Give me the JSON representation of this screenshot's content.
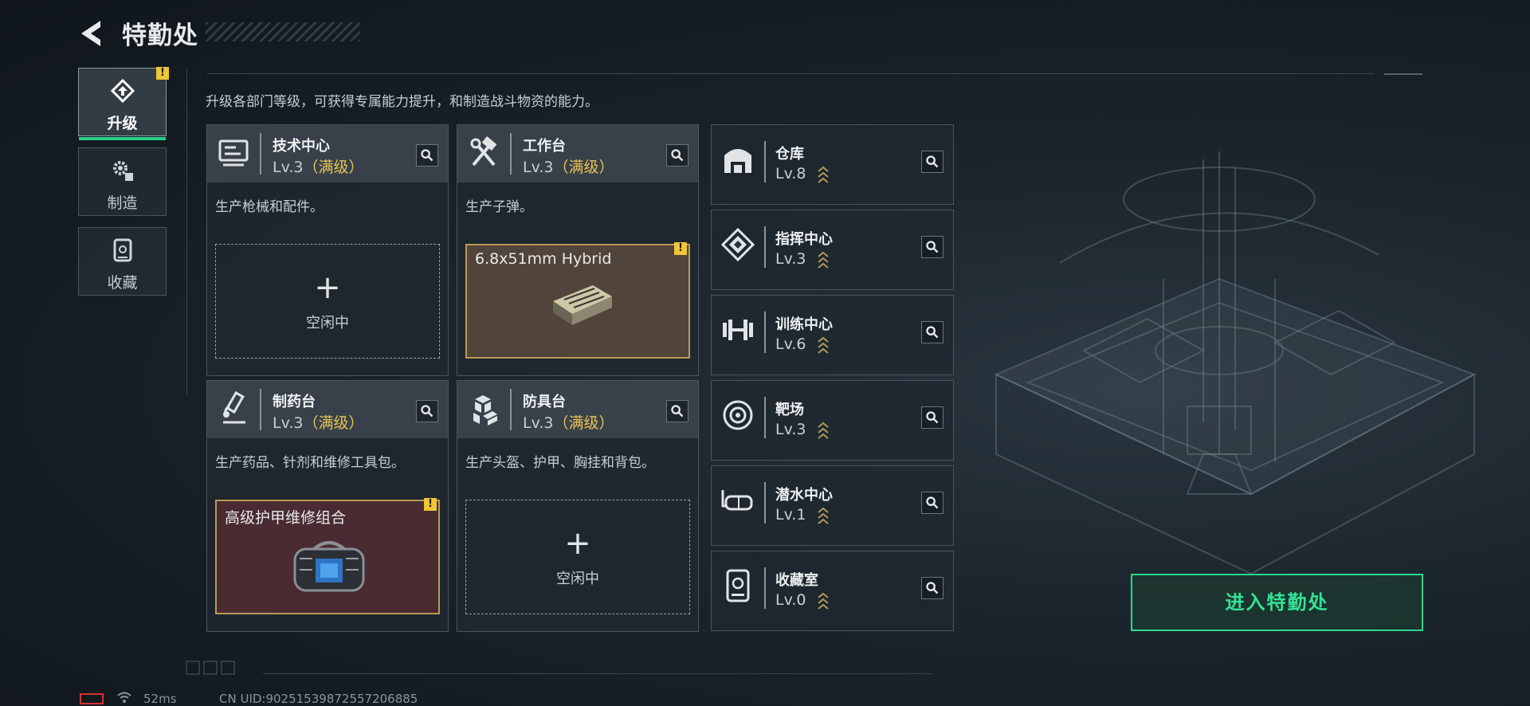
{
  "header": {
    "title": "特勤处"
  },
  "nav": [
    {
      "label": "升级",
      "icon": "upgrade-icon",
      "active": true,
      "warning": "!"
    },
    {
      "label": "制造",
      "icon": "gears-icon",
      "active": false
    },
    {
      "label": "收藏",
      "icon": "collection-icon",
      "active": false
    }
  ],
  "description": "升级各部门等级，可获得专属能力提升，和制造战斗物资的能力。",
  "facilities": [
    {
      "name": "技术中心",
      "level": "Lv.3",
      "max_label": "（满级）",
      "desc": "生产枪械和配件。",
      "icon": "tech-center-icon",
      "slot": {
        "state": "empty",
        "plus": "+",
        "label": "空闲中"
      }
    },
    {
      "name": "工作台",
      "level": "Lv.3",
      "max_label": "（满级）",
      "desc": "生产子弹。",
      "icon": "workbench-icon",
      "slot": {
        "state": "busy",
        "item": "6.8x51mm Hybrid",
        "warning": "!"
      }
    },
    {
      "name": "制药台",
      "level": "Lv.3",
      "max_label": "（满级）",
      "desc": "生产药品、针剂和维修工具包。",
      "icon": "pharmacy-icon",
      "slot": {
        "state": "busy",
        "item": "高级护甲维修组合",
        "warning": "!"
      }
    },
    {
      "name": "防具台",
      "level": "Lv.3",
      "max_label": "（满级）",
      "desc": "生产头盔、护甲、胸挂和背包。",
      "icon": "armor-bench-icon",
      "slot": {
        "state": "empty",
        "plus": "+",
        "label": "空闲中"
      }
    }
  ],
  "departments": [
    {
      "name": "仓库",
      "level": "Lv.8",
      "icon": "warehouse-icon"
    },
    {
      "name": "指挥中心",
      "level": "Lv.3",
      "icon": "command-center-icon"
    },
    {
      "name": "训练中心",
      "level": "Lv.6",
      "icon": "dumbbell-icon"
    },
    {
      "name": "靶场",
      "level": "Lv.3",
      "icon": "target-icon"
    },
    {
      "name": "潜水中心",
      "level": "Lv.1",
      "icon": "diving-mask-icon"
    },
    {
      "name": "收藏室",
      "level": "Lv.0",
      "icon": "collection-room-icon"
    }
  ],
  "enter_button": "进入特勤处",
  "status": {
    "ping": "52ms",
    "uid": "CN UID:90251539872557206885"
  },
  "colors": {
    "accent": "#29d08a",
    "max_level": "#e8c252",
    "warning": "#f0c537"
  }
}
